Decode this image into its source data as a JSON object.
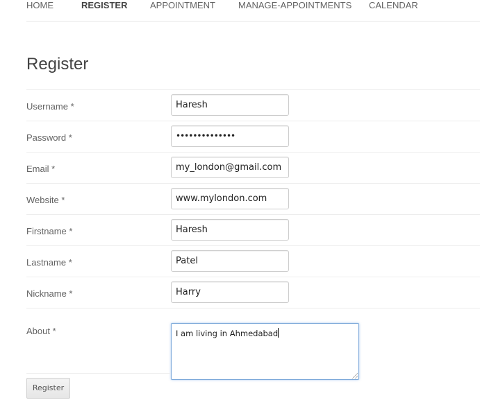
{
  "nav": {
    "items": [
      {
        "label": "HOME",
        "active": false
      },
      {
        "label": "REGISTER",
        "active": true
      },
      {
        "label": "APPOINTMENT",
        "active": false
      },
      {
        "label": "MANAGE-APPOINTMENTS",
        "active": false
      },
      {
        "label": "CALENDAR",
        "active": false
      }
    ]
  },
  "page": {
    "title": "Register"
  },
  "form": {
    "fields": [
      {
        "label": "Username *",
        "value": "Haresh",
        "type": "text"
      },
      {
        "label": "Password *",
        "value": "••••••••••••••",
        "type": "password"
      },
      {
        "label": "Email *",
        "value": "my_london@gmail.com",
        "type": "text"
      },
      {
        "label": "Website *",
        "value": "www.mylondon.com",
        "type": "text"
      },
      {
        "label": "Firstname *",
        "value": "Haresh",
        "type": "text"
      },
      {
        "label": "Lastname *",
        "value": "Patel",
        "type": "text"
      },
      {
        "label": "Nickname *",
        "value": "Harry",
        "type": "text"
      }
    ],
    "about": {
      "label": "About *",
      "value": "I am living in Ahmedabad"
    },
    "submit_label": "Register"
  },
  "colors": {
    "text": "#636363",
    "heading": "#444444",
    "border": "#cccccc",
    "focus_border": "#7aa7d9",
    "divider": "#ededed"
  }
}
